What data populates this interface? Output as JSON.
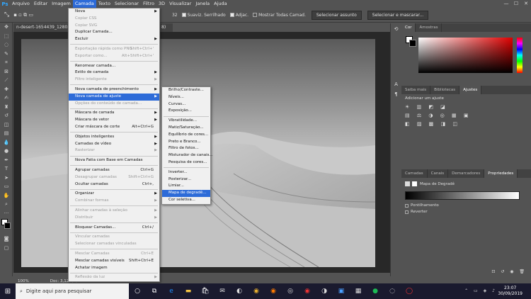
{
  "menubar": {
    "app_icon": "Ps",
    "items": [
      "Arquivo",
      "Editar",
      "Imagem",
      "Camada",
      "Texto",
      "Selecionar",
      "Filtro",
      "3D",
      "Visualizar",
      "Janela",
      "Ajuda"
    ],
    "active": "Camada"
  },
  "optbar": {
    "value": "32",
    "sample_all": "Suaviz. Serrilhado",
    "adjust": "Adjac.",
    "show_all": "Mostrar Todas Camad.",
    "select_subject": "Selecionar assunto",
    "select_mask": "Selecionar e mascarar..."
  },
  "document": {
    "tab": "n-desert-1654439_1280.jpg @ ...",
    "tab_suffix": "8)",
    "zoom": "100%",
    "doc_info": "Doc: 3,12M/3,12M"
  },
  "layer_menu": [
    {
      "label": "Nova",
      "arrow": true
    },
    {
      "label": "Copiar CSS",
      "disabled": true
    },
    {
      "label": "Copiar SVG",
      "disabled": true
    },
    {
      "label": "Duplicar Camada..."
    },
    {
      "label": "Excluir",
      "arrow": true
    },
    {
      "sep": true
    },
    {
      "label": "Exportação rápida como PNG",
      "shortcut": "Shift+Ctrl+'",
      "disabled": true
    },
    {
      "label": "Exportar como...",
      "shortcut": "Alt+Shift+Ctrl+'",
      "disabled": true
    },
    {
      "sep": true
    },
    {
      "label": "Renomear camada..."
    },
    {
      "label": "Estilo de camada",
      "arrow": true
    },
    {
      "label": "Filtro inteligente",
      "arrow": true,
      "disabled": true
    },
    {
      "sep": true
    },
    {
      "label": "Nova camada de preenchimento",
      "arrow": true
    },
    {
      "label": "Nova camada de ajuste",
      "arrow": true,
      "highlight": true
    },
    {
      "label": "Opções do conteúdo de camada...",
      "disabled": true
    },
    {
      "sep": true
    },
    {
      "label": "Máscara de camada",
      "arrow": true
    },
    {
      "label": "Máscara de vetor",
      "arrow": true
    },
    {
      "label": "Criar máscara de corte",
      "shortcut": "Alt+Ctrl+G"
    },
    {
      "sep": true
    },
    {
      "label": "Objetos inteligentes",
      "arrow": true
    },
    {
      "label": "Camadas de vídeo",
      "arrow": true
    },
    {
      "label": "Rasterizar",
      "arrow": true,
      "disabled": true
    },
    {
      "sep": true
    },
    {
      "label": "Nova Fatia com Base em Camadas"
    },
    {
      "sep": true
    },
    {
      "label": "Agrupar camadas",
      "shortcut": "Ctrl+G"
    },
    {
      "label": "Desagrupar camadas",
      "shortcut": "Shift+Ctrl+G",
      "disabled": true
    },
    {
      "label": "Ocultar camadas",
      "shortcut": "Ctrl+,"
    },
    {
      "sep": true
    },
    {
      "label": "Organizar",
      "arrow": true
    },
    {
      "label": "Combinar formas",
      "arrow": true,
      "disabled": true
    },
    {
      "sep": true
    },
    {
      "label": "Alinhar camadas à seleção",
      "arrow": true,
      "disabled": true
    },
    {
      "label": "Distribuir",
      "arrow": true,
      "disabled": true
    },
    {
      "sep": true
    },
    {
      "label": "Bloquear Camadas...",
      "shortcut": "Ctrl+/"
    },
    {
      "sep": true
    },
    {
      "label": "Vincular camadas",
      "disabled": true
    },
    {
      "label": "Selecionar camadas vinculadas",
      "disabled": true
    },
    {
      "sep": true
    },
    {
      "label": "Mesclar Camadas",
      "shortcut": "Ctrl+E",
      "disabled": true
    },
    {
      "label": "Mesclar camadas visíveis",
      "shortcut": "Shift+Ctrl+E"
    },
    {
      "label": "Achatar imagem"
    },
    {
      "sep": true
    },
    {
      "label": "Reflexão da luz",
      "arrow": true,
      "disabled": true
    }
  ],
  "adjust_submenu": [
    {
      "label": "Brilho/Contraste..."
    },
    {
      "label": "Níveis..."
    },
    {
      "label": "Curvas..."
    },
    {
      "label": "Exposição..."
    },
    {
      "sep": true
    },
    {
      "label": "Vibratilidade..."
    },
    {
      "label": "Matiz/Saturação..."
    },
    {
      "label": "Equilíbrio de cores..."
    },
    {
      "label": "Preto e Branco..."
    },
    {
      "label": "Filtro de fotos..."
    },
    {
      "label": "Misturador de canais..."
    },
    {
      "label": "Pesquisa de cores..."
    },
    {
      "sep": true
    },
    {
      "label": "Inverter..."
    },
    {
      "label": "Posterizar..."
    },
    {
      "label": "Limiar..."
    },
    {
      "label": "Mapa de degradê...",
      "highlight": true
    },
    {
      "label": "Cor seletiva..."
    }
  ],
  "panels": {
    "color_tabs": [
      "Cor",
      "Amostras"
    ],
    "adjust_tabs": [
      "Saiba mais",
      "Bibliotecas",
      "Ajustes"
    ],
    "add_adjustment": "Adicionar um ajuste",
    "props_tabs": [
      "Camadas",
      "Canais",
      "Demarcadores",
      "Propriedades"
    ],
    "gradient_map": "Mapa de Degradê",
    "dither": "Pontilhamento",
    "reverse": "Reverter"
  },
  "taskbar": {
    "search_placeholder": "Digite aqui para pesquisar",
    "time": "23:07",
    "date": "30/09/2019"
  },
  "colors": {
    "accent": "#2d6bd8",
    "panel": "#535353",
    "dark": "#282828"
  }
}
